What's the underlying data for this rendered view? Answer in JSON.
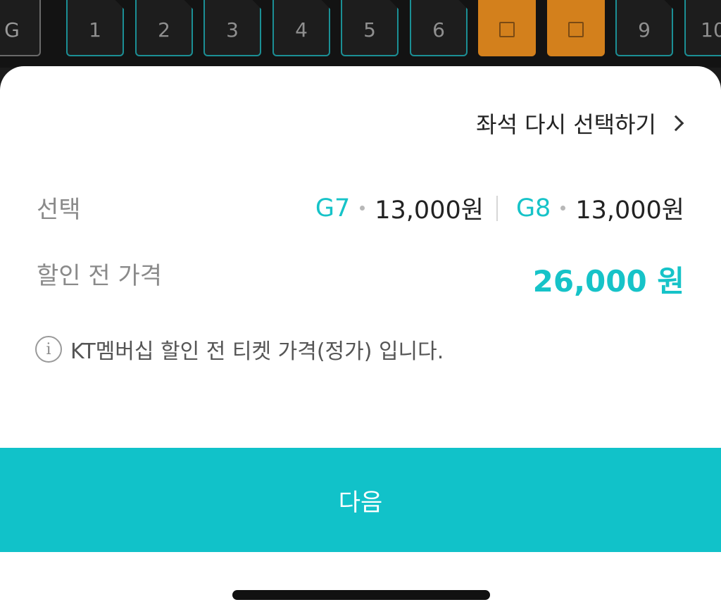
{
  "seat_map": {
    "row_label": "G",
    "seats": [
      {
        "label": "1",
        "state": "available"
      },
      {
        "label": "2",
        "state": "available"
      },
      {
        "label": "3",
        "state": "available"
      },
      {
        "label": "4",
        "state": "available"
      },
      {
        "label": "5",
        "state": "available"
      },
      {
        "label": "6",
        "state": "available"
      },
      {
        "label": "",
        "state": "selected"
      },
      {
        "label": "",
        "state": "selected"
      },
      {
        "label": "9",
        "state": "available"
      },
      {
        "label": "10",
        "state": "available"
      }
    ]
  },
  "sheet": {
    "reselect_label": "좌석 다시 선택하기",
    "selection_label": "선택",
    "selections": [
      {
        "seat": "G7",
        "price": "13,000원"
      },
      {
        "seat": "G8",
        "price": "13,000원"
      }
    ],
    "pre_discount_label": "할인 전 가격",
    "total_price": "26,000 원",
    "notice": "KT멤버십 할인 전 티켓 가격(정가) 입니다.",
    "info_icon": "i",
    "next_label": "다음"
  },
  "colors": {
    "accent": "#11c2c9",
    "selected_seat": "#d3801c",
    "seat_border": "#1b8f95"
  }
}
